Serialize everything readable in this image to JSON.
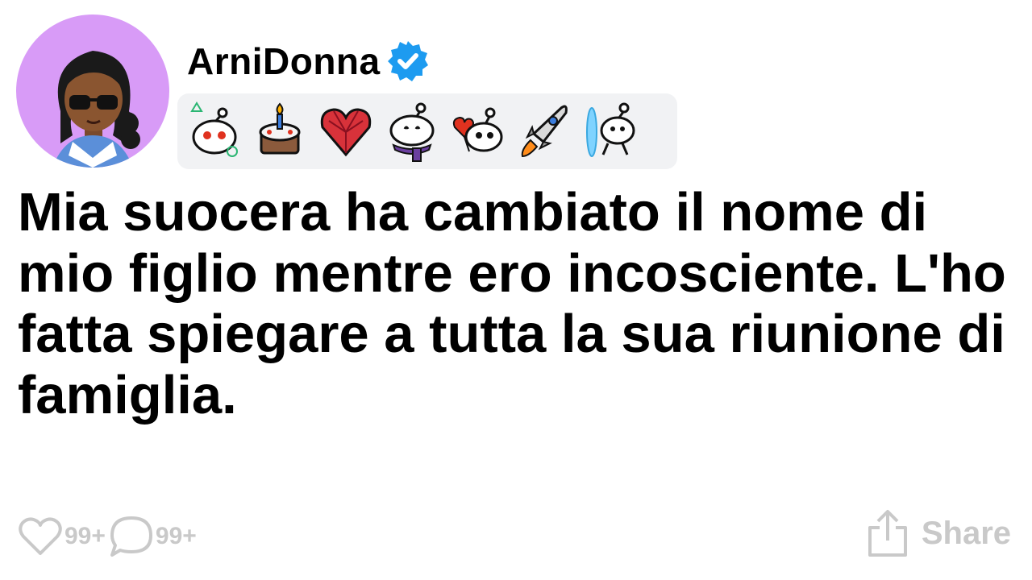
{
  "post": {
    "username": "ArniDonna",
    "title": "Mia suocera ha cambiato il nome di mio figlio mentre ero incosciente. L'ho fatta spiegare a tutta la sua riunione di famiglia."
  },
  "badges": [
    {
      "icon": "snoo-shapes-icon"
    },
    {
      "icon": "birthday-cake-icon"
    },
    {
      "icon": "gem-heart-icon"
    },
    {
      "icon": "snoo-scarf-icon"
    },
    {
      "icon": "snoo-heart-balloon-icon"
    },
    {
      "icon": "rocket-icon"
    },
    {
      "icon": "snoo-portal-icon"
    }
  ],
  "actions": {
    "likes": "99+",
    "comments": "99+",
    "share_label": "Share"
  },
  "colors": {
    "avatar_bg": "#d89bf7",
    "verified": "#1d9bf0",
    "badge_bar": "#f1f2f4",
    "action_gray": "#c9c9c9"
  }
}
